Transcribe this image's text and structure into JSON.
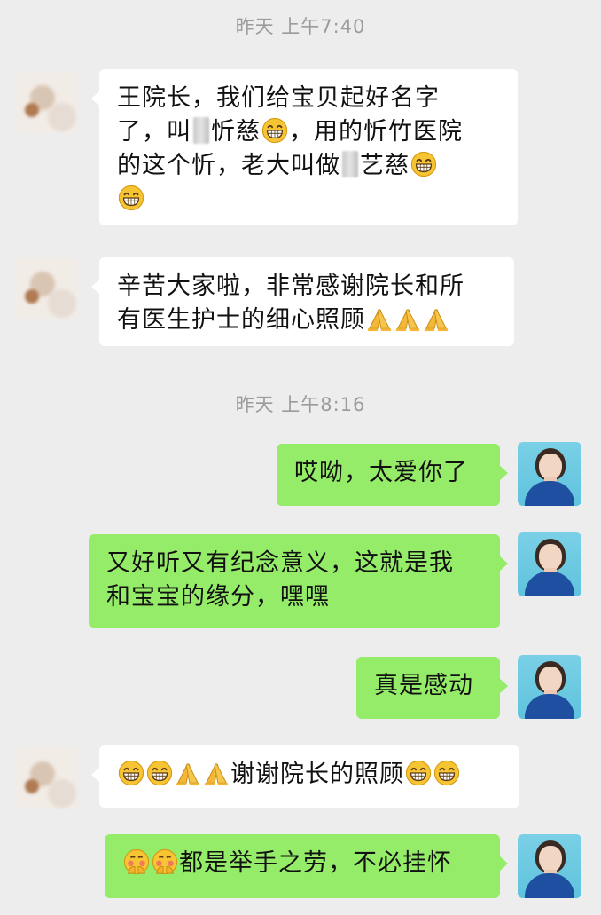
{
  "timestamps": {
    "first": "昨天 上午7:40",
    "second": "昨天 上午8:16"
  },
  "messages": {
    "m1": {
      "p1": "王院长，我们给宝贝起好名字",
      "p2a": "了，叫",
      "p2b": "忻慈",
      "p2c": "，用的忻竹医院",
      "p3a": "的这个忻，老大叫做",
      "p3b": "艺慈"
    },
    "m2": {
      "l1": "辛苦大家啦，非常感谢院长和所",
      "l2": "有医生护士的细心照顾"
    },
    "m3": {
      "text": "哎呦，太爱你了"
    },
    "m4": {
      "l1": "又好听又有纪念意义，这就是我",
      "l2": "和宝宝的缘分，嘿嘿"
    },
    "m5": {
      "text": "真是感动"
    },
    "m6": {
      "text": "谢谢院长的照顾"
    },
    "m7": {
      "text": "都是举手之劳，不必挂怀"
    }
  },
  "icons": {
    "grin": "grinning-face-emoji",
    "pray": "folded-hands-emoji",
    "shy": "blushing-covered-face-emoji"
  },
  "colors": {
    "background": "#ededed",
    "sent_bubble": "#95ec69",
    "received_bubble": "#ffffff",
    "timestamp_text": "#9b9b9b"
  }
}
